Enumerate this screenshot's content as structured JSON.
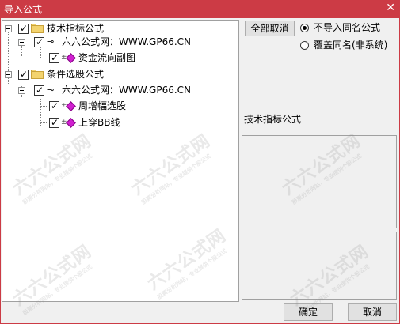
{
  "window": {
    "title": "导入公式",
    "close_glyph": "✕"
  },
  "tree": {
    "groups": [
      {
        "label": "技术指标公式",
        "source": "六六公式网：WWW.GP66.CN",
        "items": [
          "资金流向副图"
        ]
      },
      {
        "label": "条件选股公式",
        "source": "六六公式网：WWW.GP66.CN",
        "items": [
          "周增幅选股",
          "上穿BB线"
        ]
      }
    ],
    "key_glyph": "⊸",
    "item_prefix": "±"
  },
  "options": {
    "cancel_all_label": "全部取消",
    "radio_no_import": "不导入同名公式",
    "radio_overwrite": "覆盖同名(非系统)",
    "selected": "radio_no_import"
  },
  "right_panel": {
    "section_label": "技术指标公式"
  },
  "footer": {
    "ok_label": "确定",
    "cancel_label": "取消"
  },
  "watermark": {
    "brand": "六六公式网",
    "sub": "股票分析网站，专业提供个股公式"
  },
  "colors": {
    "titlebar": "#cc3b45",
    "item_icon": "#d020d0",
    "folder": "#f3d36e"
  }
}
